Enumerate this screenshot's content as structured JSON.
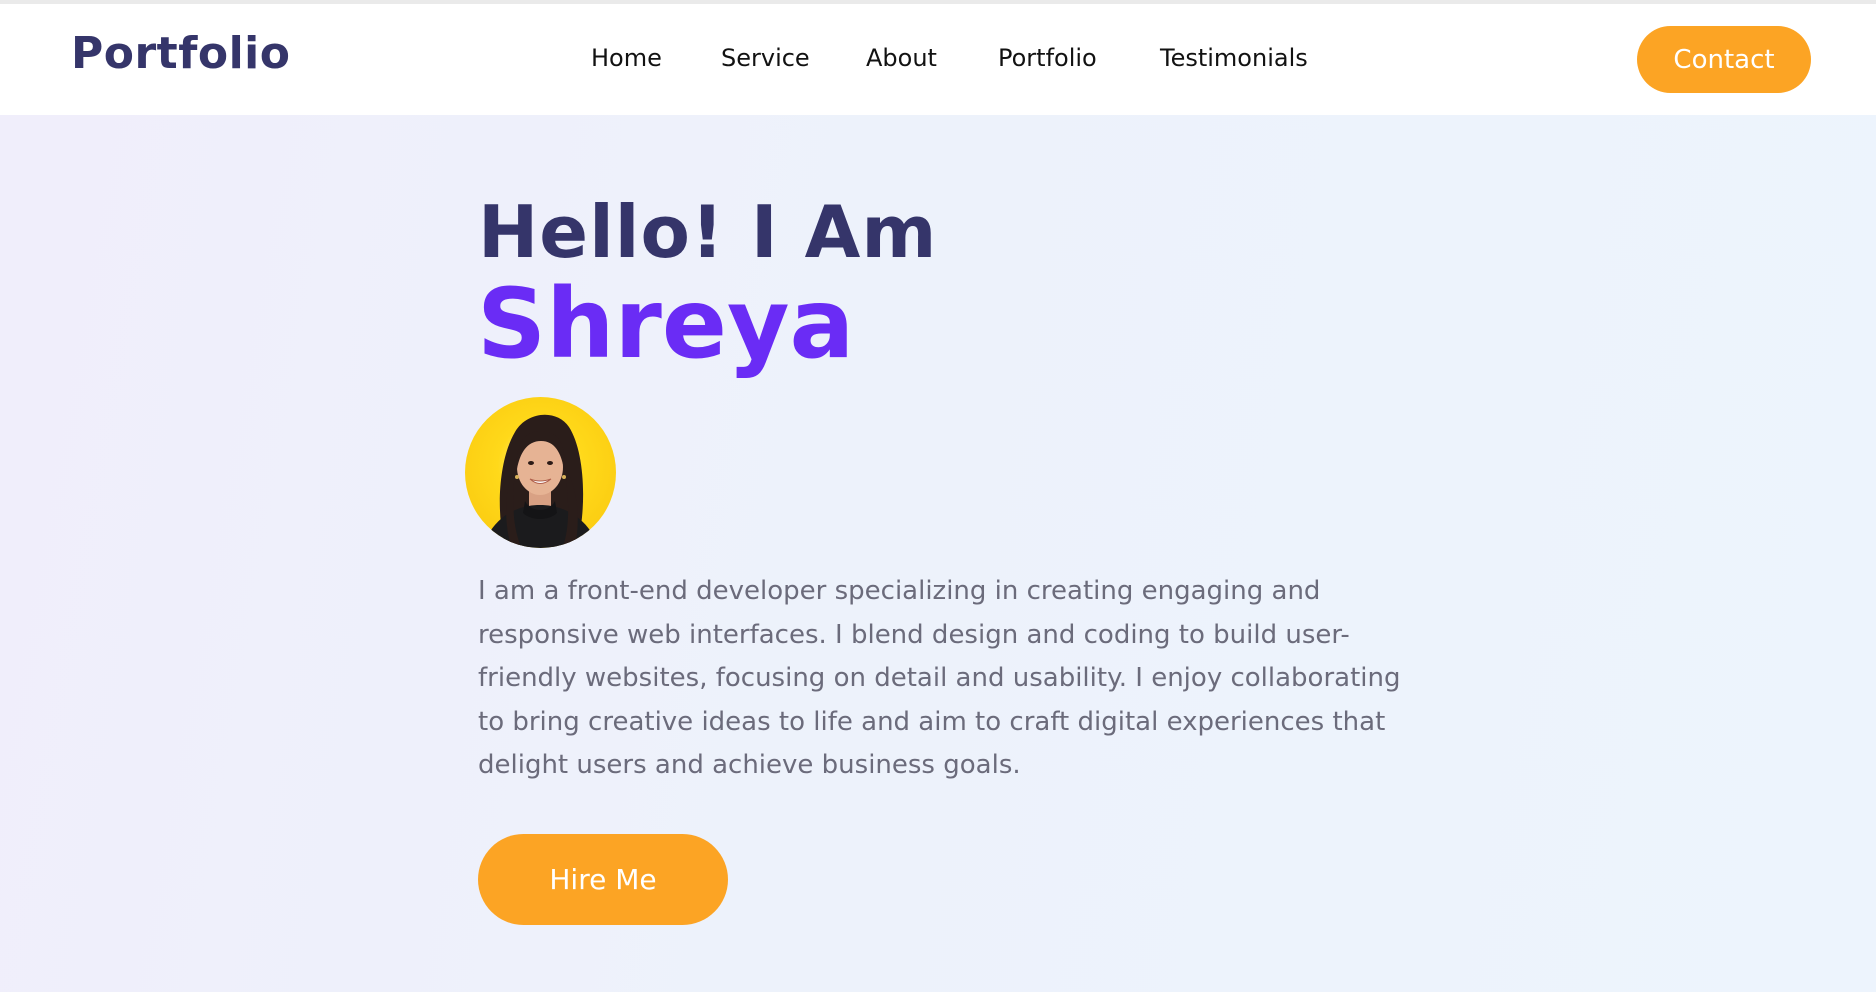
{
  "header": {
    "brand": "Portfolio",
    "nav": [
      {
        "label": "Home"
      },
      {
        "label": "Service"
      },
      {
        "label": "About"
      },
      {
        "label": "Portfolio"
      },
      {
        "label": "Testimonials"
      }
    ],
    "contact_label": "Contact"
  },
  "hero": {
    "greeting": "Hello! I Am",
    "name": "Shreya",
    "avatar_icon": "profile-photo",
    "bio": "I am a front-end developer specializing in creating engaging and responsive web interfaces. I blend design and coding to build user-friendly websites, focusing on detail and usability. I enjoy collaborating to bring creative ideas to life and aim to craft digital experiences that delight users and achieve business goals.",
    "hire_label": "Hire Me"
  },
  "colors": {
    "brand": "#35356a",
    "accent": "#fca424",
    "name_purple": "#6a2cf5",
    "body_text": "#6b6b7b",
    "hero_bg": "#eef3fb"
  }
}
